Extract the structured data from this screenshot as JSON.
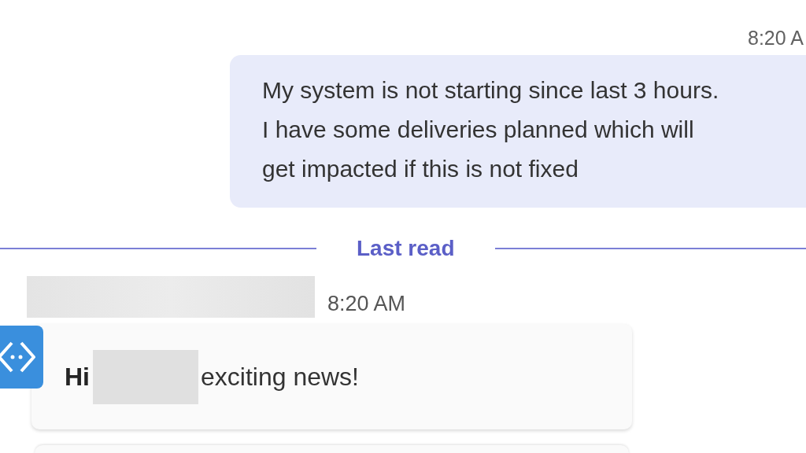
{
  "sent_message": {
    "time": "8:20 A",
    "lines": [
      "My system is not starting since last 3 hours.",
      "I have some deliveries planned which will",
      "get impacted if this is not fixed"
    ]
  },
  "divider": {
    "label": "Last read"
  },
  "received_message": {
    "time": "8:20 AM",
    "greeting": "Hi",
    "text": "exciting news!"
  }
}
